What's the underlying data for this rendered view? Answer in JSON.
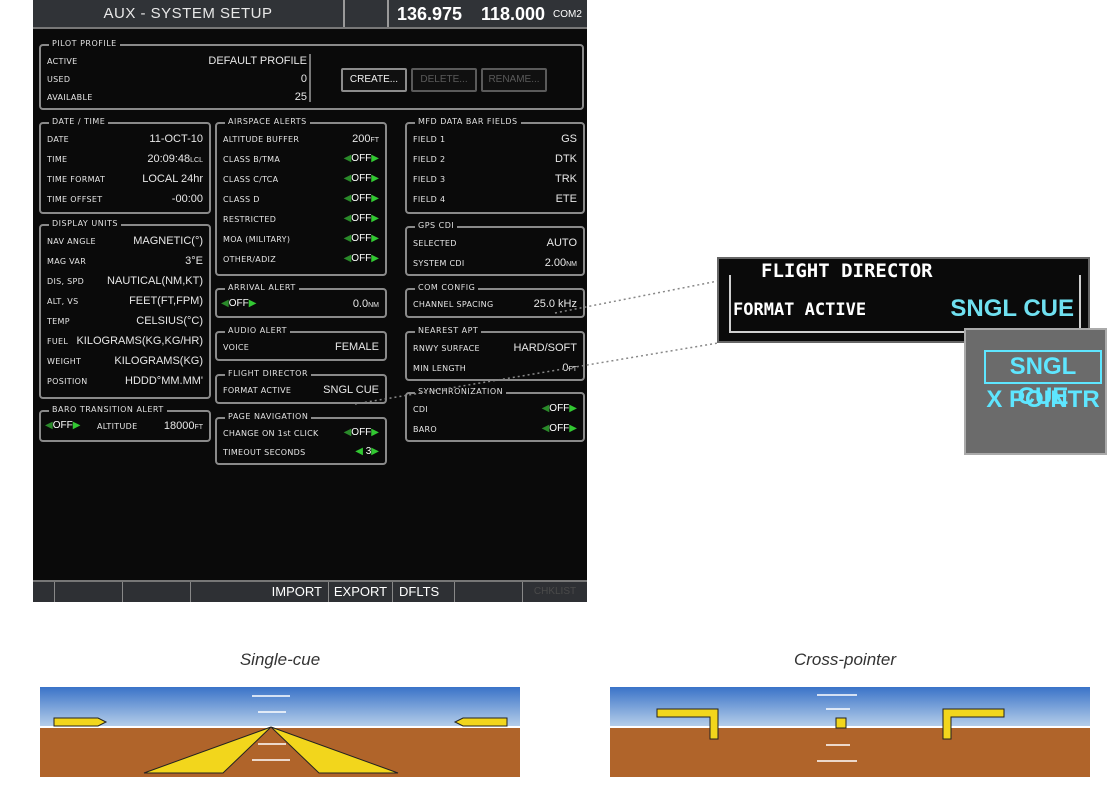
{
  "topbar": {
    "title": "AUX - SYSTEM SETUP",
    "active_freq": "136.975",
    "standby_freq": "118.000",
    "com_label": "COM2"
  },
  "pilot_profile": {
    "title": "PILOT PROFILE",
    "active_label": "ACTIVE",
    "active_value": "DEFAULT PROFILE",
    "used_label": "USED",
    "used_value": "0",
    "available_label": "AVAILABLE",
    "available_value": "25",
    "create": "CREATE...",
    "delete": "DELETE...",
    "rename": "RENAME..."
  },
  "date_time": {
    "title": "DATE / TIME",
    "date_label": "DATE",
    "date_value": "11-OCT-10",
    "time_label": "TIME",
    "time_value": "20:09:48",
    "time_unit": "LCL",
    "format_label": "TIME FORMAT",
    "format_value": "LOCAL 24hr",
    "offset_label": "TIME OFFSET",
    "offset_value": "-00:00"
  },
  "display_units": {
    "title": "DISPLAY UNITS",
    "rows": [
      {
        "label": "NAV ANGLE",
        "value": "MAGNETIC(°)"
      },
      {
        "label": "MAG VAR",
        "value": "3°E"
      },
      {
        "label": "DIS, SPD",
        "value": "NAUTICAL(NM,KT)"
      },
      {
        "label": "ALT, VS",
        "value": "FEET(FT,FPM)"
      },
      {
        "label": "TEMP",
        "value": "CELSIUS(°C)"
      },
      {
        "label": "FUEL",
        "value": "KILOGRAMS(KG,KG/HR)"
      },
      {
        "label": "WEIGHT",
        "value": "KILOGRAMS(KG)"
      },
      {
        "label": "POSITION",
        "value": "HDDD°MM.MM'"
      }
    ]
  },
  "baro_transition": {
    "title": "BARO TRANSITION ALERT",
    "state": "OFF",
    "alt_label": "ALTITUDE",
    "alt_value": "18000",
    "alt_unit": "FT"
  },
  "airspace_alerts": {
    "title": "AIRSPACE ALERTS",
    "buffer_label": "ALTITUDE BUFFER",
    "buffer_value": "200",
    "buffer_unit": "FT",
    "rows": [
      {
        "label": "CLASS B/TMA",
        "value": "OFF"
      },
      {
        "label": "CLASS C/TCA",
        "value": "OFF"
      },
      {
        "label": "CLASS D",
        "value": "OFF"
      },
      {
        "label": "RESTRICTED",
        "value": "OFF"
      },
      {
        "label": "MOA (MILITARY)",
        "value": "OFF"
      },
      {
        "label": "OTHER/ADIZ",
        "value": "OFF"
      }
    ]
  },
  "arrival_alert": {
    "title": "ARRIVAL ALERT",
    "state": "OFF",
    "value": "0.0",
    "unit": "NM"
  },
  "audio_alert": {
    "title": "AUDIO ALERT",
    "voice_label": "VOICE",
    "voice_value": "FEMALE"
  },
  "flight_director": {
    "title": "FLIGHT DIRECTOR",
    "format_label": "FORMAT ACTIVE",
    "format_value": "SNGL CUE"
  },
  "page_navigation": {
    "title": "PAGE NAVIGATION",
    "change_label": "CHANGE ON 1st CLICK",
    "change_value": "OFF",
    "timeout_label": "TIMEOUT SECONDS",
    "timeout_value": "3"
  },
  "mfd_fields": {
    "title": "MFD DATA BAR FIELDS",
    "rows": [
      {
        "label": "FIELD 1",
        "value": "GS"
      },
      {
        "label": "FIELD 2",
        "value": "DTK"
      },
      {
        "label": "FIELD 3",
        "value": "TRK"
      },
      {
        "label": "FIELD 4",
        "value": "ETE"
      }
    ]
  },
  "gps_cdi": {
    "title": "GPS CDI",
    "selected_label": "SELECTED",
    "selected_value": "AUTO",
    "system_label": "SYSTEM CDI",
    "system_value": "2.00",
    "system_unit": "NM"
  },
  "com_config": {
    "title": "COM CONFIG",
    "spacing_label": "CHANNEL SPACING",
    "spacing_value": "25.0 kHz"
  },
  "nearest_apt": {
    "title": "NEAREST APT",
    "surface_label": "RNWY SURFACE",
    "surface_value": "HARD/SOFT",
    "min_label": "MIN LENGTH",
    "min_value": "0",
    "min_unit": "FT"
  },
  "synchronization": {
    "title": "SYNCHRONIZATION",
    "cdi_label": "CDI",
    "cdi_value": "OFF",
    "baro_label": "BARO",
    "baro_value": "OFF"
  },
  "softkeys": [
    "",
    "",
    "",
    "IMPORT",
    "EXPORT",
    "DFLTS",
    "",
    "CHKLIST"
  ],
  "callout": {
    "title": "FLIGHT DIRECTOR",
    "label": "FORMAT ACTIVE",
    "value": "SNGL CUE"
  },
  "popup": {
    "options": [
      "SNGL CUE",
      "X POINTR"
    ]
  },
  "depictions": {
    "single_caption": "Single-cue",
    "cross_caption": "Cross-pointer"
  },
  "colors": {
    "sky_top": "#3a73c8",
    "sky_bottom": "#b8d0ea",
    "ground": "#b0642a",
    "fd_yellow": "#f2d61c",
    "cyan": "#5ee6ff"
  }
}
